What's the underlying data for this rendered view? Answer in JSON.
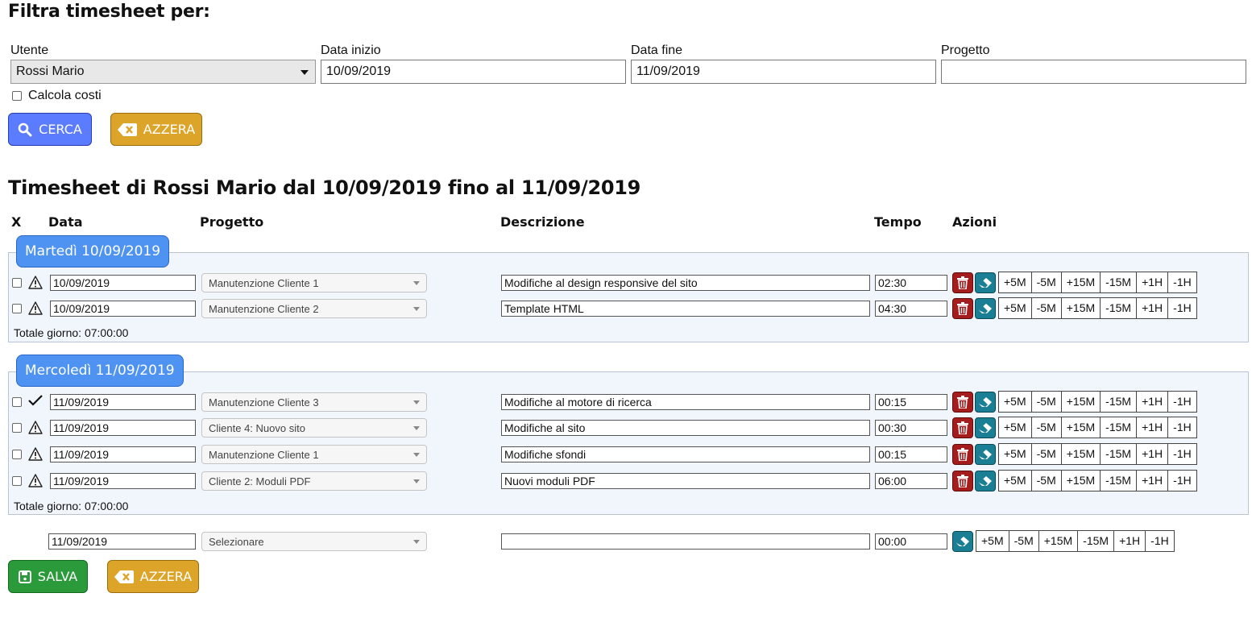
{
  "filter": {
    "title": "Filtra timesheet per:",
    "utente_label": "Utente",
    "utente_value": "Rossi Mario",
    "data_inizio_label": "Data inizio",
    "data_inizio_value": "10/09/2019",
    "data_fine_label": "Data fine",
    "data_fine_value": "11/09/2019",
    "progetto_label": "Progetto",
    "progetto_value": "",
    "calcola_costi_label": "Calcola costi",
    "cerca_label": "CERCA",
    "azzera_label": "AZZERA"
  },
  "timesheet": {
    "title": "Timesheet di Rossi Mario dal 10/09/2019 fino al 11/09/2019",
    "columns": {
      "x": "X",
      "data": "Data",
      "progetto": "Progetto",
      "descrizione": "Descrizione",
      "tempo": "Tempo",
      "azioni": "Azioni"
    },
    "adjust": [
      "+5M",
      "-5M",
      "+15M",
      "-15M",
      "+1H",
      "-1H"
    ],
    "days": [
      {
        "label": "Martedì 10/09/2019",
        "total": "Totale giorno: 07:00:00",
        "rows": [
          {
            "status": "warning",
            "date": "10/09/2019",
            "project": "Manutenzione Cliente 1",
            "description": "Modifiche al design responsive del sito",
            "time": "02:30"
          },
          {
            "status": "warning",
            "date": "10/09/2019",
            "project": "Manutenzione Cliente 2",
            "description": "Template HTML",
            "time": "04:30"
          }
        ]
      },
      {
        "label": "Mercoledì 11/09/2019",
        "total": "Totale giorno: 07:00:00",
        "rows": [
          {
            "status": "ok",
            "date": "11/09/2019",
            "project": "Manutenzione Cliente 3",
            "description": "Modifiche al motore di ricerca",
            "time": "00:15"
          },
          {
            "status": "warning",
            "date": "11/09/2019",
            "project": "Cliente 4: Nuovo sito",
            "description": "Modifiche al sito",
            "time": "00:30"
          },
          {
            "status": "warning",
            "date": "11/09/2019",
            "project": "Manutenzione Cliente 1",
            "description": "Modifiche sfondi",
            "time": "00:15"
          },
          {
            "status": "warning",
            "date": "11/09/2019",
            "project": "Cliente 2: Moduli PDF",
            "description": "Nuovi moduli PDF",
            "time": "06:00"
          }
        ]
      }
    ],
    "new_row": {
      "date": "11/09/2019",
      "project": "Selezionare",
      "description": "",
      "time": "00:00"
    },
    "salva_label": "SALVA",
    "azzera_label": "AZZERA"
  },
  "colors": {
    "cerca": "#5b7cff",
    "azzera": "#dca428",
    "salva": "#2a9a3a",
    "trash": "#a51c1c",
    "eraser": "#1a7f94",
    "day_badge": "#4f93f2"
  }
}
